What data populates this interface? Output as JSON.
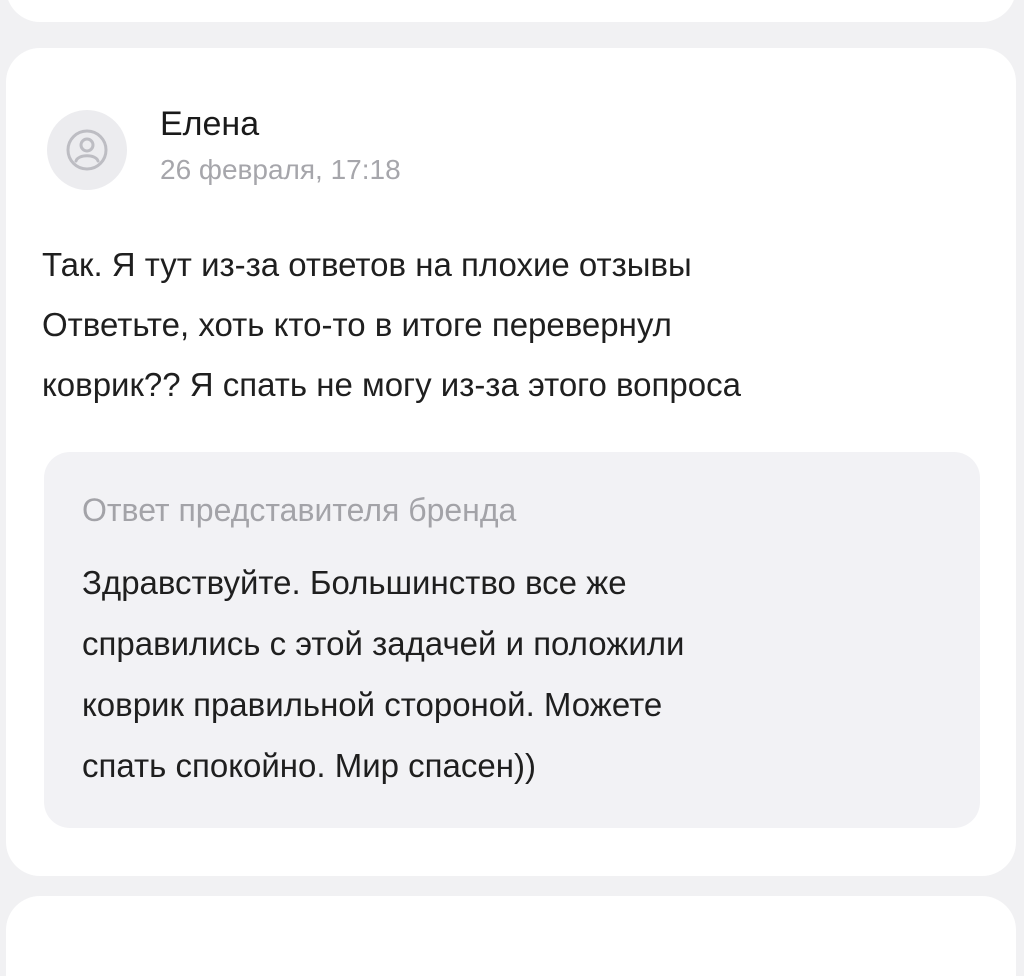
{
  "review": {
    "author": "Елена",
    "date": "26 февраля, 17:18",
    "text_lines": [
      "Так. Я тут из-за ответов на плохие отзывы",
      "Ответьте, хоть кто-то в итоге перевернул",
      "коврик?? Я спать не могу из-за этого вопроса"
    ],
    "avatar_icon": "user-icon"
  },
  "brand_reply": {
    "title": "Ответ представителя бренда",
    "text_lines": [
      "Здравствуйте. Большинство все же",
      "справились с этой задачей и положили",
      "коврик правильной стороной. Можете",
      "спать спокойно. Мир спасен))"
    ]
  },
  "colors": {
    "background": "#f1f1f3",
    "card": "#ffffff",
    "reply_box": "#f2f2f5",
    "muted_text": "#a6a6ab",
    "main_text": "#1f1f1f"
  }
}
